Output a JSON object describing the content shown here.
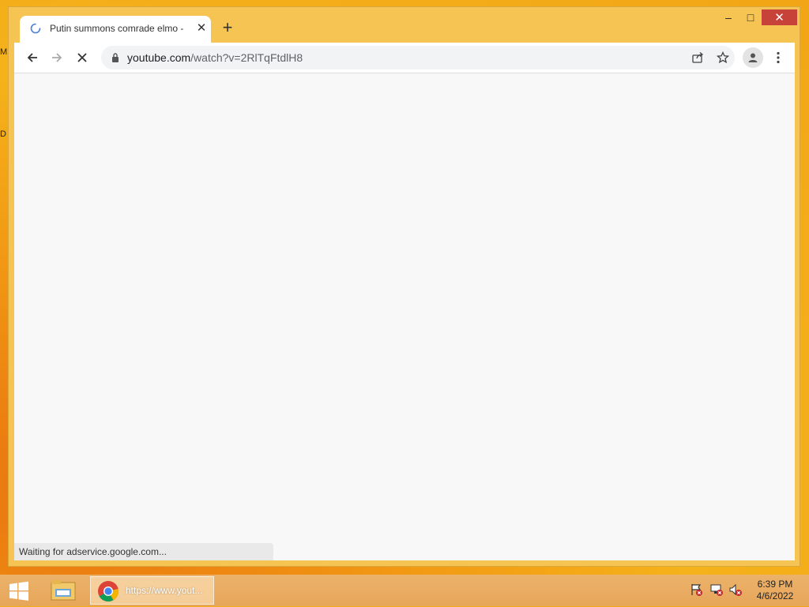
{
  "desktop": {
    "stub_top": "M",
    "stub_mid": "D"
  },
  "window": {
    "caption": {
      "minimize": "–",
      "maximize": "□",
      "close": "✕"
    },
    "tab": {
      "title": "Putin summons comrade elmo -",
      "close": "✕"
    },
    "new_tab": "+"
  },
  "toolbar": {
    "url_host": "youtube.com",
    "url_path": "/watch?v=2RlTqFtdlH8"
  },
  "status_bar": {
    "text": "Waiting for adservice.google.com..."
  },
  "taskbar": {
    "chrome_task_label": "https://www.yout...",
    "clock_time": "6:39 PM",
    "clock_date": "4/6/2022"
  },
  "colors": {
    "titlebar": "#f6c453",
    "close_button": "#c7433a",
    "spinner": "#4a7fd6"
  },
  "icons": [
    "back-arrow-icon",
    "forward-arrow-icon",
    "stop-icon",
    "lock-icon",
    "share-icon",
    "star-icon",
    "profile-icon",
    "kebab-menu-icon",
    "loading-spinner-icon",
    "windows-logo-icon",
    "file-explorer-icon",
    "chrome-logo-icon",
    "action-center-flag-icon",
    "network-icon",
    "volume-muted-icon"
  ]
}
